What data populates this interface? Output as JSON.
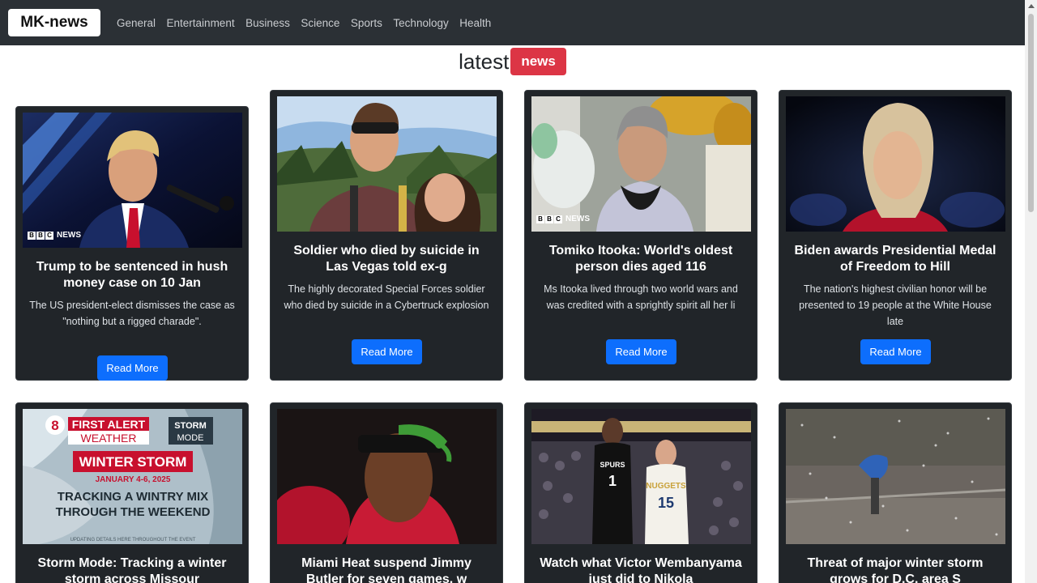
{
  "navbar": {
    "brand": "MK-news",
    "links": [
      "General",
      "Entertainment",
      "Business",
      "Science",
      "Sports",
      "Technology",
      "Health"
    ]
  },
  "heading": {
    "text": "latest",
    "badge": "news"
  },
  "watermark": {
    "letters": [
      "B",
      "B",
      "C"
    ],
    "text": "NEWS"
  },
  "cards": [
    {
      "title": "Trump to be sentenced in hush money case on 10 Jan",
      "description": "The US president-elect dismisses the case as \"nothing but a rigged charade\".",
      "button": "Read More"
    },
    {
      "title": "Soldier who died by suicide in Las Vegas told ex-g",
      "description": "The highly decorated Special Forces soldier who died by suicide in a Cybertruck explosion",
      "button": "Read More"
    },
    {
      "title": "Tomiko Itooka: World's oldest person dies aged 116",
      "description": "Ms Itooka lived through two world wars and was credited with a sprightly spirit all her li",
      "button": "Read More"
    },
    {
      "title": "Biden awards Presidential Medal of Freedom to Hill",
      "description": "The nation's highest civilian honor will be presented to 19 people at the White House late",
      "button": "Read More"
    },
    {
      "title": "Storm Mode: Tracking a winter storm across Missour"
    },
    {
      "title": "Miami Heat suspend Jimmy Butler for seven games, w"
    },
    {
      "title": "Watch what Victor Wembanyama just did to Nikola"
    },
    {
      "title": "Threat of major winter storm grows for D.C. area S"
    }
  ],
  "storm_graphic": {
    "logo_top": "FIRST ALERT",
    "logo_bottom": "WEATHER",
    "mode_top": "STORM",
    "mode_bottom": "MODE",
    "banner": "WINTER STORM",
    "dates": "JANUARY 4-6, 2025",
    "line1": "TRACKING A WINTRY MIX",
    "line2": "THROUGH THE WEEKEND",
    "footer": "UPDATING DETAILS HERE THROUGHOUT THE EVENT"
  },
  "jerseys": {
    "left_team": "SPURS",
    "right_team": "NUGGETS",
    "right_number": "15",
    "left_number": "1"
  }
}
